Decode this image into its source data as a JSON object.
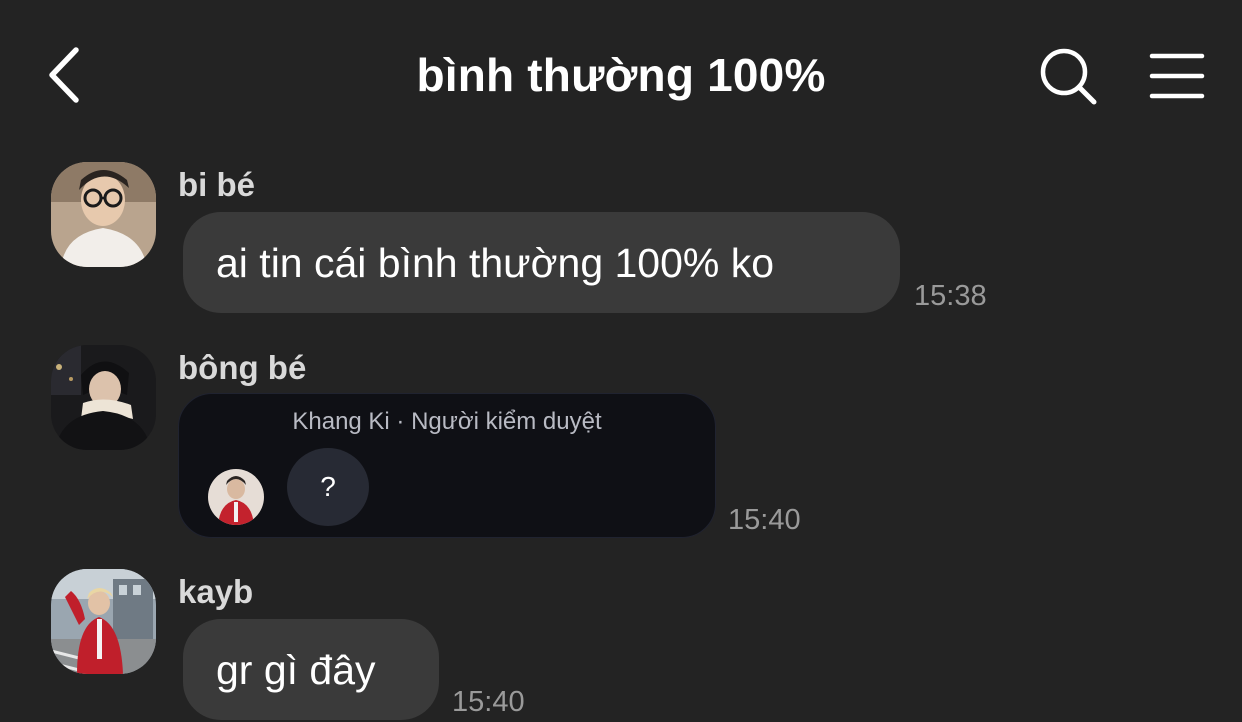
{
  "header": {
    "title": "bình thường 100%",
    "back_icon": "chevron-left-icon",
    "search_icon": "search-icon",
    "menu_icon": "hamburger-menu-icon"
  },
  "messages": [
    {
      "sender": "bi bé",
      "text": "ai tin cái bình thường 100% ko",
      "time": "15:38"
    },
    {
      "sender": "bông bé",
      "card": {
        "header": "Khang Ki · Người kiểm duyệt",
        "reply_text": "?"
      },
      "time": "15:40"
    },
    {
      "sender": "kayb",
      "text": "gr gì đây",
      "time": "15:40"
    }
  ],
  "colors": {
    "background": "#232323",
    "bubble": "#3a3a3a",
    "card": "#0f1015",
    "timestamp": "#9a9a9a"
  }
}
